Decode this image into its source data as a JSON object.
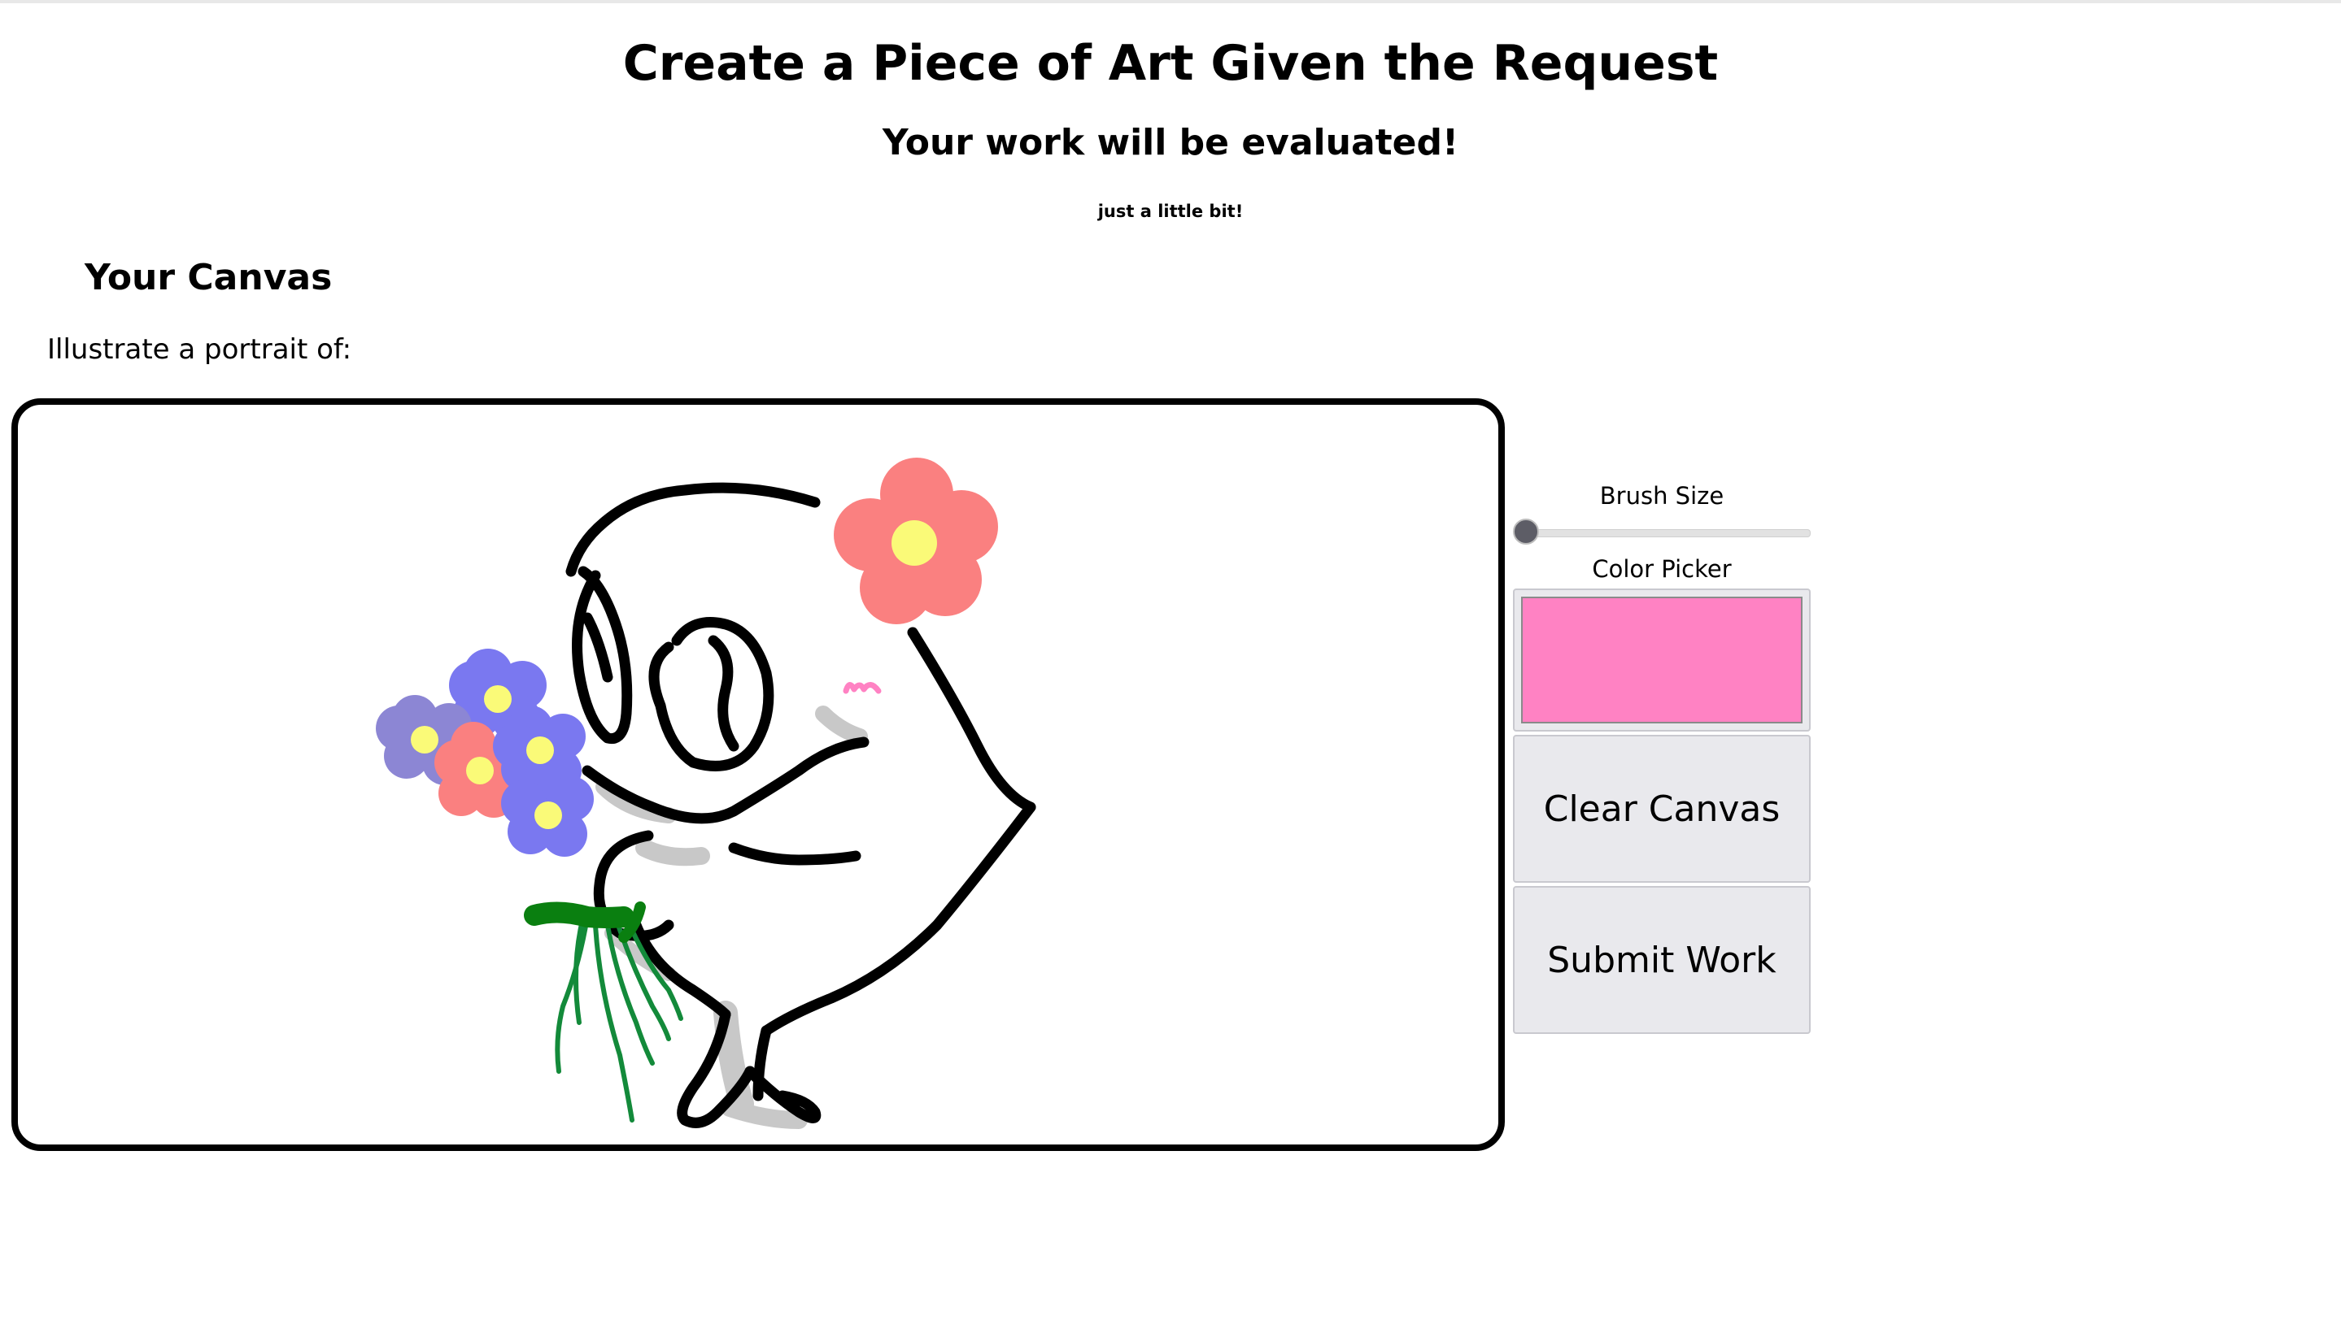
{
  "header": {
    "title": "Create a Piece of Art Given the Request",
    "subtitle": "Your work will be evaluated!",
    "note": "just a little bit!"
  },
  "canvas_section": {
    "heading": "Your Canvas",
    "prompt": "Illustrate a portrait of:"
  },
  "controls": {
    "brush_size_label": "Brush Size",
    "brush_size_fraction": 0.0,
    "color_picker_label": "Color Picker",
    "selected_color": "#ff82c3",
    "clear_label": "Clear Canvas",
    "submit_label": "Submit Work"
  },
  "colors": {
    "stroke": "#000000",
    "shading": "#c8c8c8",
    "flower_red": "#fa8080",
    "flower_blue": "#7a78f0",
    "flower_purple": "#8c86d4",
    "flower_center": "#fafa78",
    "stem_green": "#138a3a",
    "bow_green": "#0a7f10",
    "blush_pink": "#ff82c3"
  }
}
